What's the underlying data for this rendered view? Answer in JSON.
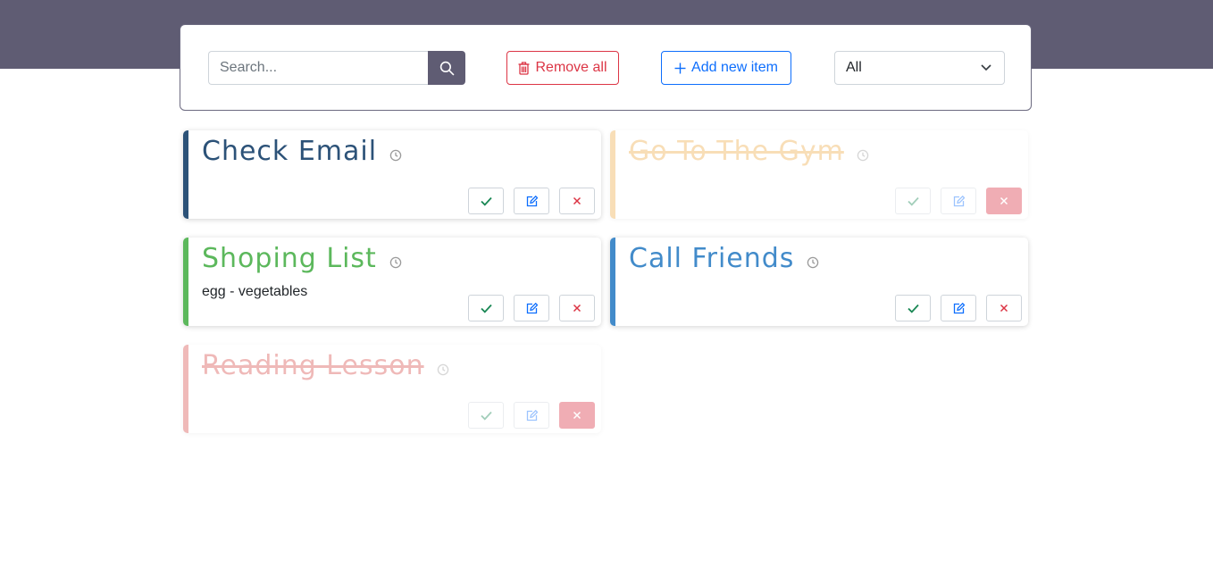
{
  "toolbar": {
    "search_placeholder": "Search...",
    "remove_all_label": "Remove all",
    "add_new_label": "Add new item",
    "filter_selected": "All"
  },
  "items": [
    {
      "title": "Check Email",
      "description": "",
      "done": false,
      "color": "#2c5278"
    },
    {
      "title": "Go To The Gym",
      "description": "",
      "done": true,
      "color": "#f0ad4e"
    },
    {
      "title": "Shoping List",
      "description": "egg - vegetables",
      "done": false,
      "color": "#5cb85c"
    },
    {
      "title": "Call Friends",
      "description": "",
      "done": false,
      "color": "#428bca"
    },
    {
      "title": "Reading Lesson",
      "description": "",
      "done": true,
      "color": "#d9534f"
    }
  ],
  "icons": {
    "search": "search-icon",
    "trash": "trash-icon",
    "plus": "plus-icon",
    "chevron": "chevron-down-icon",
    "clock": "clock-icon",
    "check": "check-icon",
    "edit": "edit-icon",
    "close": "close-icon"
  }
}
